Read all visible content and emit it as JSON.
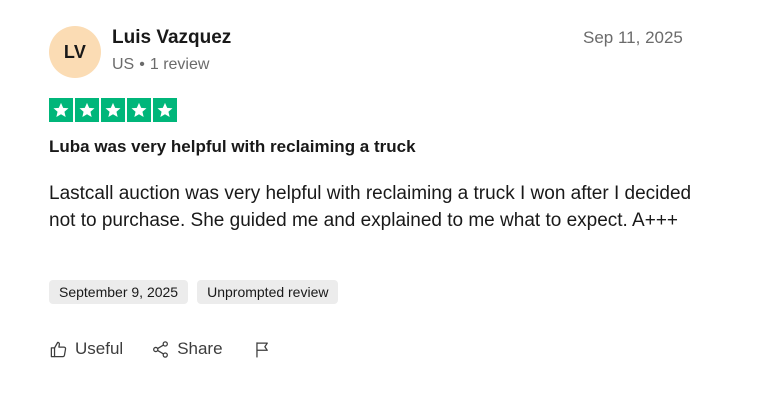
{
  "reviewer": {
    "initials": "LV",
    "name": "Luis Vazquez",
    "country": "US",
    "separator": "•",
    "review_count": "1 review"
  },
  "review": {
    "date": "Sep 11, 2025",
    "rating": 5,
    "rating_max": 5,
    "title": "Luba was very helpful with reclaiming a truck",
    "body": "Lastcall auction was very helpful with reclaiming a truck I won after I decided not to purchase. She guided me and explained to me what to expect. A+++",
    "experience_date": "September 9, 2025",
    "badge": "Unprompted review"
  },
  "actions": {
    "useful_label": "Useful",
    "share_label": "Share",
    "useful_icon": "thumbs-up-icon",
    "share_icon": "share-icon",
    "flag_icon": "flag-icon"
  },
  "colors": {
    "star_green": "#00b67a",
    "avatar_bg": "#fbdcb4",
    "tag_bg": "#ececec",
    "muted_text": "#6b6b6b"
  }
}
